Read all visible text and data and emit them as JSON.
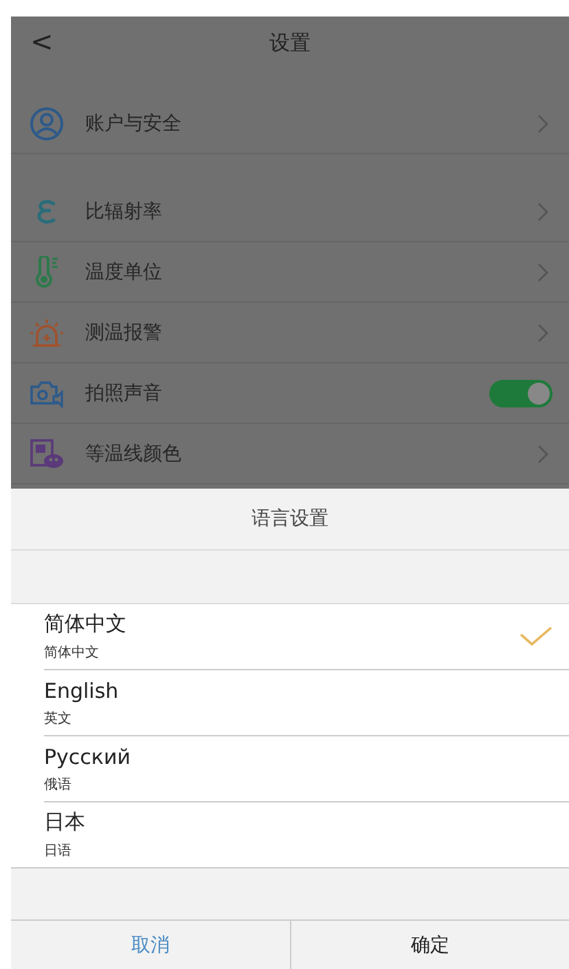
{
  "header": {
    "back": "<",
    "title": "设置"
  },
  "account": {
    "label": "账户与安全",
    "kind": "link"
  },
  "settings": [
    {
      "label": "比辐射率",
      "kind": "link"
    },
    {
      "label": "温度单位",
      "kind": "link"
    },
    {
      "label": "测温报警",
      "kind": "link"
    },
    {
      "label": "拍照声音",
      "kind": "toggle",
      "on": true
    },
    {
      "label": "等温线颜色",
      "kind": "link"
    }
  ],
  "sheet": {
    "title": "语言设置",
    "options": [
      {
        "name": "简体中文",
        "subtitle": "简体中文",
        "selected": true
      },
      {
        "name": "English",
        "subtitle": "英文",
        "selected": false
      },
      {
        "name": "Русский",
        "subtitle": "俄语",
        "selected": false
      },
      {
        "name": "日本",
        "subtitle": "日语",
        "selected": false
      }
    ],
    "buttons": [
      {
        "label": "取消",
        "kind": "cancel"
      },
      {
        "label": "确定",
        "kind": "confirm"
      }
    ]
  }
}
